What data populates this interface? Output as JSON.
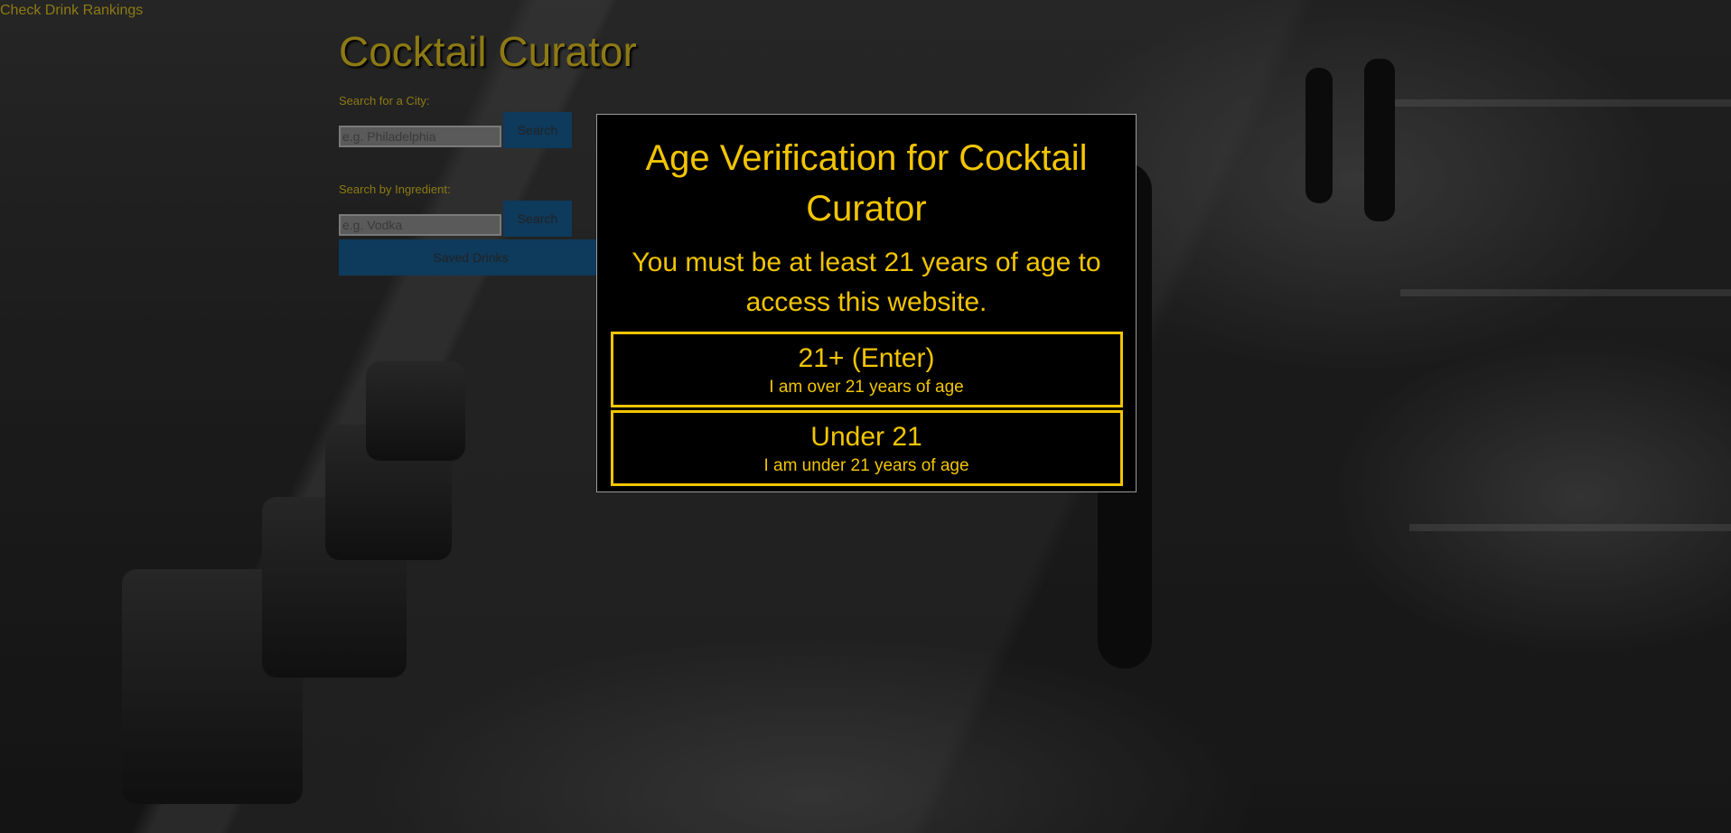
{
  "nav": {
    "rankings_link": "Check Drink Rankings"
  },
  "header": {
    "title": "Cocktail Curator"
  },
  "city_search": {
    "label": "Search for a City:",
    "placeholder": "e.g. Philadelphia",
    "button": "Search"
  },
  "ingredient_search": {
    "label": "Search by Ingredient:",
    "placeholder": "e.g. Vodka",
    "button": "Search"
  },
  "saved_button": "Saved Drinks",
  "age_modal": {
    "title": "Age Verification for Cocktail Curator",
    "message": "You must be at least 21 years of age to access this website.",
    "enter": {
      "heading": "21+ (Enter)",
      "subtext": "I am over 21 years of age"
    },
    "under": {
      "heading": "Under 21",
      "subtext": "I am under 21 years of age"
    }
  },
  "colors": {
    "accent_yellow": "#f2c500",
    "dim_gold": "#8d7a14",
    "button_blue": "#0e3a5c",
    "modal_bg": "#000000"
  }
}
